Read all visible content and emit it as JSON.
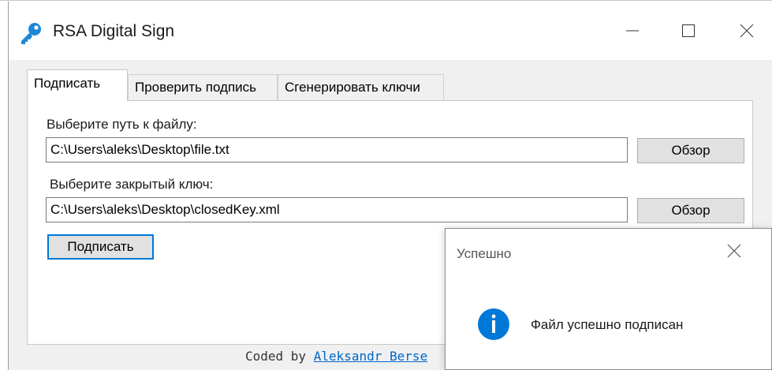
{
  "window": {
    "title": "RSA Digital Sign",
    "icon": "key-icon"
  },
  "tabs": [
    {
      "label": "Подписать",
      "active": true
    },
    {
      "label": "Проверить подпись",
      "active": false
    },
    {
      "label": "Сгенерировать ключи",
      "active": false
    }
  ],
  "sign": {
    "file_label": "Выберите путь к файлу:",
    "file_value": "C:\\Users\\aleks\\Desktop\\file.txt",
    "file_browse": "Обзор",
    "key_label": "Выберите закрытый ключ:",
    "key_value": "C:\\Users\\aleks\\Desktop\\closedKey.xml",
    "key_browse": "Обзор",
    "sign_button": "Подписать"
  },
  "footer": {
    "prefix": "Coded by ",
    "author": "Aleksandr Berse"
  },
  "dialog": {
    "title": "Успешно",
    "message": "Файл успешно подписан",
    "icon": "info-icon"
  },
  "colors": {
    "accent": "#0078d7",
    "link": "#0066cc"
  }
}
